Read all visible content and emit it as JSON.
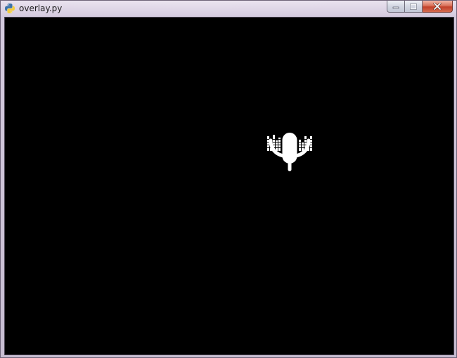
{
  "window": {
    "title": "overlay.py",
    "app_icon": "python-icon"
  },
  "caption_buttons": {
    "minimize_icon": "minimize-icon",
    "maximize_icon": "maximize-icon",
    "close_icon": "close-icon"
  },
  "overlay": {
    "background_color": "#000000",
    "mic_icon": "microphone-icon",
    "equalizer_icon": "audio-level-bars-icon",
    "icon_color": "#ffffff"
  }
}
